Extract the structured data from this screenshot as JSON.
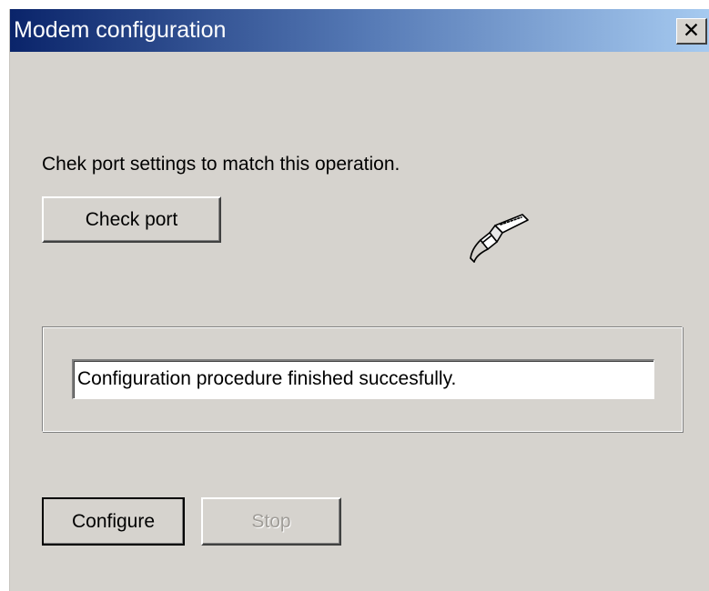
{
  "window": {
    "title": "Modem configuration",
    "close_glyph": "✕",
    "close_icon": "close-icon",
    "title_gradient": [
      "#0a246a",
      "#a6caf0"
    ],
    "background_color": "#d6d3ce"
  },
  "port": {
    "prompt": "Chek port settings to match this operation.",
    "check_button_label": "Check port",
    "icon": "serial-cable-plug-icon"
  },
  "status": {
    "message": "Configuration procedure finished succesfully."
  },
  "actions": {
    "configure_label": "Configure",
    "stop_label": "Stop",
    "stop_enabled": false
  }
}
